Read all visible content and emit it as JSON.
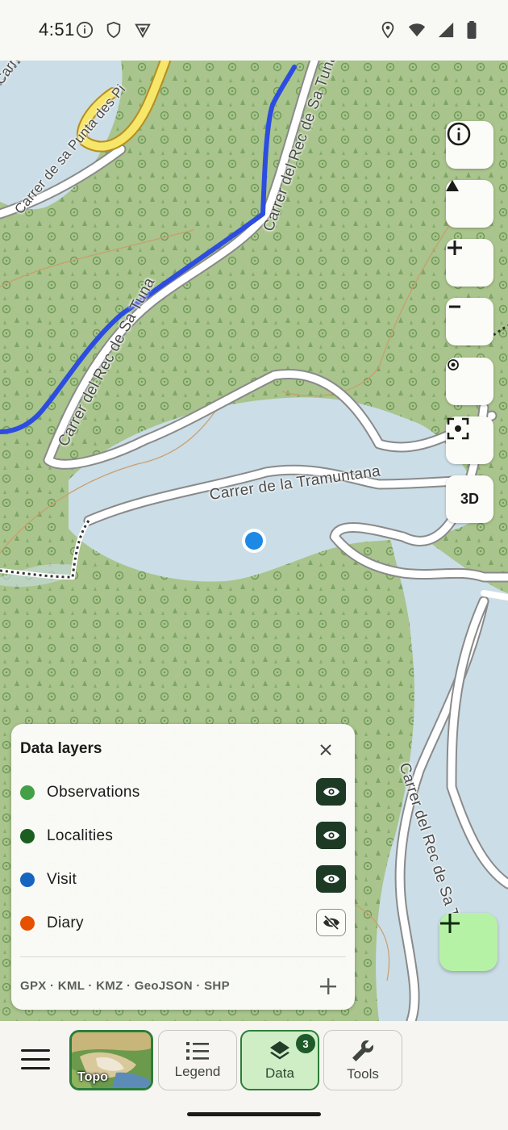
{
  "status_bar": {
    "time": "4:51",
    "left_icons": [
      "info-icon",
      "shield-icon",
      "vpn-icon"
    ],
    "right_icons": [
      "location-icon",
      "wifi-icon",
      "signal-icon",
      "battery-icon"
    ]
  },
  "map": {
    "street_labels": [
      "Carretera C",
      "Carrer de sa Punta des Pi",
      "Carrer del Rec de Sa Tuna",
      "Carrer del Rec de Sa Tuna",
      "Carrer de la Tramuntana",
      "Carrer del Rec de Sa Tuna"
    ],
    "controls": {
      "info": "info-icon",
      "north": "compass-arrow-icon",
      "zoom_in": "plus-icon",
      "zoom_out": "minus-icon",
      "locate": "target-icon",
      "fit": "fullscreen-focus-icon",
      "three_d_label": "3D"
    },
    "add_button_icon": "plus-icon"
  },
  "layers_panel": {
    "title": "Data layers",
    "close_icon": "close-icon",
    "layers": [
      {
        "name": "Observations",
        "color": "#43a047",
        "visible": true
      },
      {
        "name": "Localities",
        "color": "#1b5e20",
        "visible": true
      },
      {
        "name": "Visit",
        "color": "#1565c0",
        "visible": true
      },
      {
        "name": "Diary",
        "color": "#e65100",
        "visible": false
      }
    ],
    "formats": "GPX · KML · KMZ · GeoJSON · SHP",
    "import_icon": "plus-icon"
  },
  "bottom_nav": {
    "menu_icon": "hamburger-menu-icon",
    "basemap_label": "Topo",
    "tabs": [
      {
        "label": "Legend",
        "icon": "list-icon",
        "active": false
      },
      {
        "label": "Data",
        "icon": "layers-icon",
        "active": true,
        "badge": "3"
      },
      {
        "label": "Tools",
        "icon": "wrench-icon",
        "active": false
      }
    ]
  },
  "colors": {
    "accent": "#2d7d3a",
    "fab": "#b6f2a6",
    "track": "#2d4de0",
    "location_dot": "#1e88e5"
  }
}
